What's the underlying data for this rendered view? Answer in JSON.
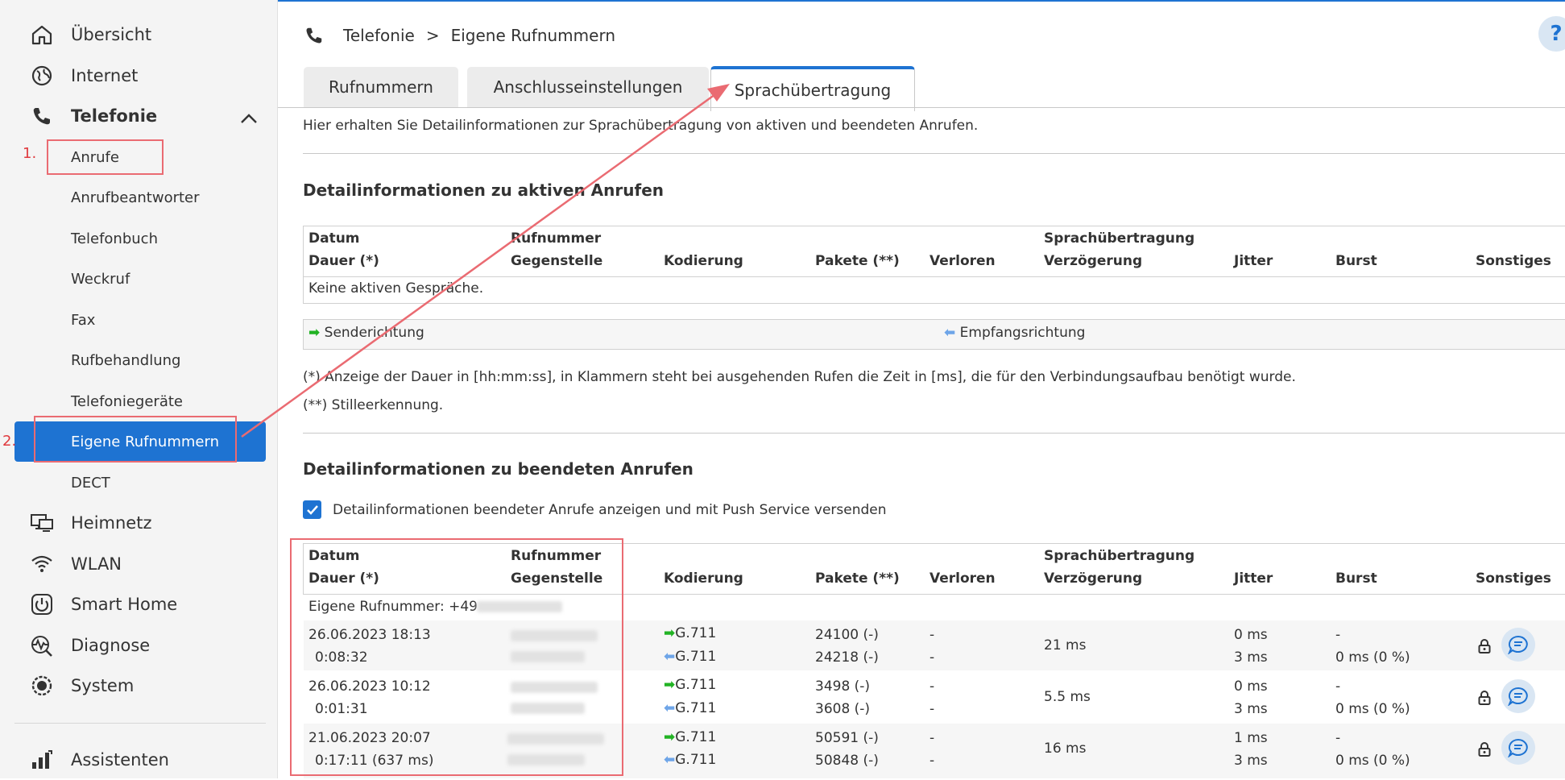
{
  "sidebar": {
    "items": [
      {
        "label": "Übersicht",
        "icon": "home-icon"
      },
      {
        "label": "Internet",
        "icon": "globe-icon"
      },
      {
        "label": "Telefonie",
        "icon": "phone-icon"
      }
    ],
    "sub_items": [
      {
        "label": "Anrufe"
      },
      {
        "label": "Anrufbeantworter"
      },
      {
        "label": "Telefonbuch"
      },
      {
        "label": "Weckruf"
      },
      {
        "label": "Fax"
      },
      {
        "label": "Rufbehandlung"
      },
      {
        "label": "Telefoniegeräte"
      },
      {
        "label": "Eigene Rufnummern"
      },
      {
        "label": "DECT"
      }
    ],
    "items_after": [
      {
        "label": "Heimnetz",
        "icon": "network-icon"
      },
      {
        "label": "WLAN",
        "icon": "wifi-icon"
      },
      {
        "label": "Smart Home",
        "icon": "power-icon"
      },
      {
        "label": "Diagnose",
        "icon": "diagnose-icon"
      },
      {
        "label": "System",
        "icon": "system-icon"
      }
    ],
    "assistant": {
      "label": "Assistenten",
      "icon": "assistant-icon"
    }
  },
  "breadcrumb": {
    "section": "Telefonie",
    "separator": ">",
    "page": "Eigene Rufnummern"
  },
  "help_label": "?",
  "tabs": [
    {
      "label": "Rufnummern"
    },
    {
      "label": "Anschlusseinstellungen"
    },
    {
      "label": "Sprachübertragung"
    }
  ],
  "intro": "Hier erhalten Sie Detailinformationen zur Sprachübertragung von aktiven und beendeten Anrufen.",
  "active": {
    "heading": "Detailinformationen zu aktiven Anrufen",
    "empty": "Keine aktiven Gespräche."
  },
  "columns": {
    "datum": "Datum",
    "dauer": "Dauer (*)",
    "rufnummer": "Rufnummer",
    "gegenstelle": "Gegenstelle",
    "kodierung": "Kodierung",
    "pakete": "Pakete (**)",
    "verloren": "Verloren",
    "sprach": "Sprachübertragung",
    "verzoegerung": "Verzögerung",
    "jitter": "Jitter",
    "burst": "Burst",
    "sonstiges": "Sonstiges"
  },
  "legend": {
    "send": "Senderichtung",
    "receive": "Empfangsrichtung"
  },
  "notes": {
    "n1": "(*) Anzeige der Dauer in [hh:mm:ss], in Klammern steht bei ausgehenden Rufen die Zeit in [ms], die für den Verbindungsaufbau benötigt wurde.",
    "n2": "(**) Stilleerkennung."
  },
  "ended": {
    "heading": "Detailinformationen zu beendeten Anrufen",
    "checkbox_label": "Detailinformationen beendeter Anrufe anzeigen und mit Push Service versenden",
    "checkbox_checked": true,
    "own_number_label": "Eigene Rufnummer: +49",
    "rows": [
      {
        "date": "26.06.2023 18:13",
        "duration": "0:08:32",
        "codec_send": "G.711",
        "codec_recv": "G.711",
        "packets_send": "24100 (-)",
        "packets_recv": "24218 (-)",
        "lost_send": "-",
        "lost_recv": "-",
        "delay": "21 ms",
        "jitter_send": "0 ms",
        "jitter_recv": "3 ms",
        "burst_send": "-",
        "burst_recv": "0 ms (0 %)"
      },
      {
        "date": "26.06.2023 10:12",
        "duration": "0:01:31",
        "codec_send": "G.711",
        "codec_recv": "G.711",
        "packets_send": "3498 (-)",
        "packets_recv": "3608 (-)",
        "lost_send": "-",
        "lost_recv": "-",
        "delay": "5.5 ms",
        "jitter_send": "0 ms",
        "jitter_recv": "3 ms",
        "burst_send": "-",
        "burst_recv": "0 ms (0 %)"
      },
      {
        "date": "21.06.2023 20:07",
        "duration": "0:17:11 (637 ms)",
        "codec_send": "G.711",
        "codec_recv": "G.711",
        "packets_send": "50591 (-)",
        "packets_recv": "50848 (-)",
        "lost_send": "-",
        "lost_recv": "-",
        "delay": "16 ms",
        "jitter_send": "1 ms",
        "jitter_recv": "3 ms",
        "burst_send": "-",
        "burst_recv": "0 ms (0 %)"
      }
    ]
  },
  "annotations": {
    "step1": "1.",
    "step2": "2."
  },
  "colors": {
    "accent": "#1e73d2",
    "annotation": "#ea6b72",
    "send_arrow": "#22b324",
    "receive_arrow": "#6ea5e8"
  }
}
